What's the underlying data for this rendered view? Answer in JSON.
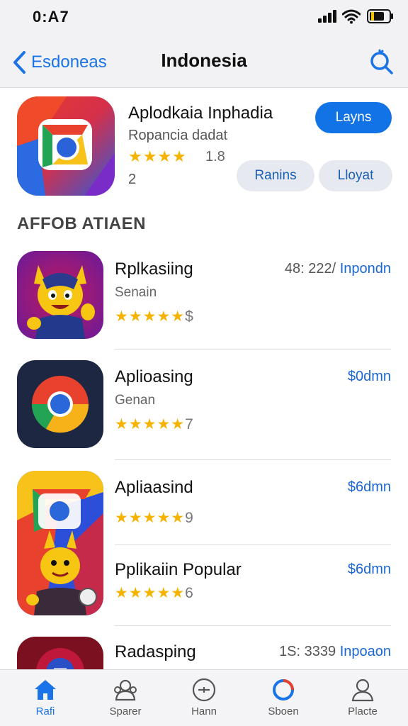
{
  "status_bar": {
    "time": "0:A7"
  },
  "nav": {
    "back_label": "Esdoneas",
    "title": "Indonesia"
  },
  "featured": {
    "title": "Aplodkaia Inphadia",
    "subtitle": "Ropancia dadat",
    "stars": "★★★★",
    "rating_count": "1.8",
    "num": "2",
    "primary_button": "Layns",
    "secondary_buttons": [
      "Ranins",
      "Lloyat"
    ]
  },
  "section": {
    "heading": "AFFOB ATIAEN"
  },
  "apps": [
    {
      "name": "Rplkasiing",
      "subtitle": "Senain",
      "stars": "★★★★★",
      "stars_tail": "$",
      "meta": "48: 222/",
      "price": "Inpondn",
      "icon": "monster-app-icon"
    },
    {
      "name": "Aplioasing",
      "subtitle": "Genan",
      "stars": "★★★★★",
      "stars_tail": "7",
      "price": "$0dmn",
      "icon": "browser-app-icon"
    },
    {
      "name": "Apliaasind",
      "subtitle": "",
      "stars": "★★★★★",
      "stars_tail": "9",
      "price": "$6dmn",
      "icon": "character-app-icon"
    },
    {
      "name": "Pplikaiin Popular",
      "subtitle": "",
      "stars": "★★★★★",
      "stars_tail": "6",
      "price": "$6dmn",
      "icon": "character-app-icon"
    },
    {
      "name": "Radasping",
      "subtitle": "",
      "stars": "",
      "stars_tail": "",
      "meta": "1S: 3339",
      "price": "Inpoaon",
      "icon": "game-app-icon"
    }
  ],
  "tabs": [
    {
      "label": "Rafi",
      "icon": "home-icon",
      "active": true
    },
    {
      "label": "Sparer",
      "icon": "people-icon",
      "active": false
    },
    {
      "label": "Hann",
      "icon": "plus-circle-icon",
      "active": false
    },
    {
      "label": "Sboen",
      "icon": "ring-icon",
      "active": false
    },
    {
      "label": "Placte",
      "icon": "person-icon",
      "active": false
    }
  ],
  "colors": {
    "accent": "#1273e6",
    "star": "#f5b300",
    "background": "#ffffff",
    "bar": "#f2f2f4"
  }
}
